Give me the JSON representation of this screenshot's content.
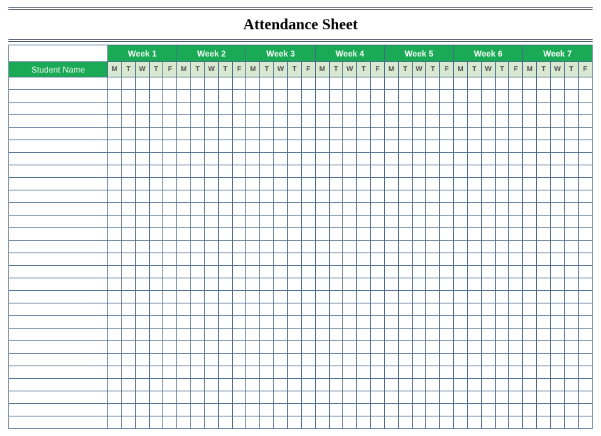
{
  "title": "Attendance Sheet",
  "student_name_header": "Student Name",
  "weeks": [
    {
      "label": "Week 1"
    },
    {
      "label": "Week 2"
    },
    {
      "label": "Week 3"
    },
    {
      "label": "Week 4"
    },
    {
      "label": "Week 5"
    },
    {
      "label": "Week 6"
    },
    {
      "label": "Week 7"
    }
  ],
  "days": [
    "M",
    "T",
    "W",
    "T",
    "F"
  ],
  "row_count": 28,
  "students": []
}
